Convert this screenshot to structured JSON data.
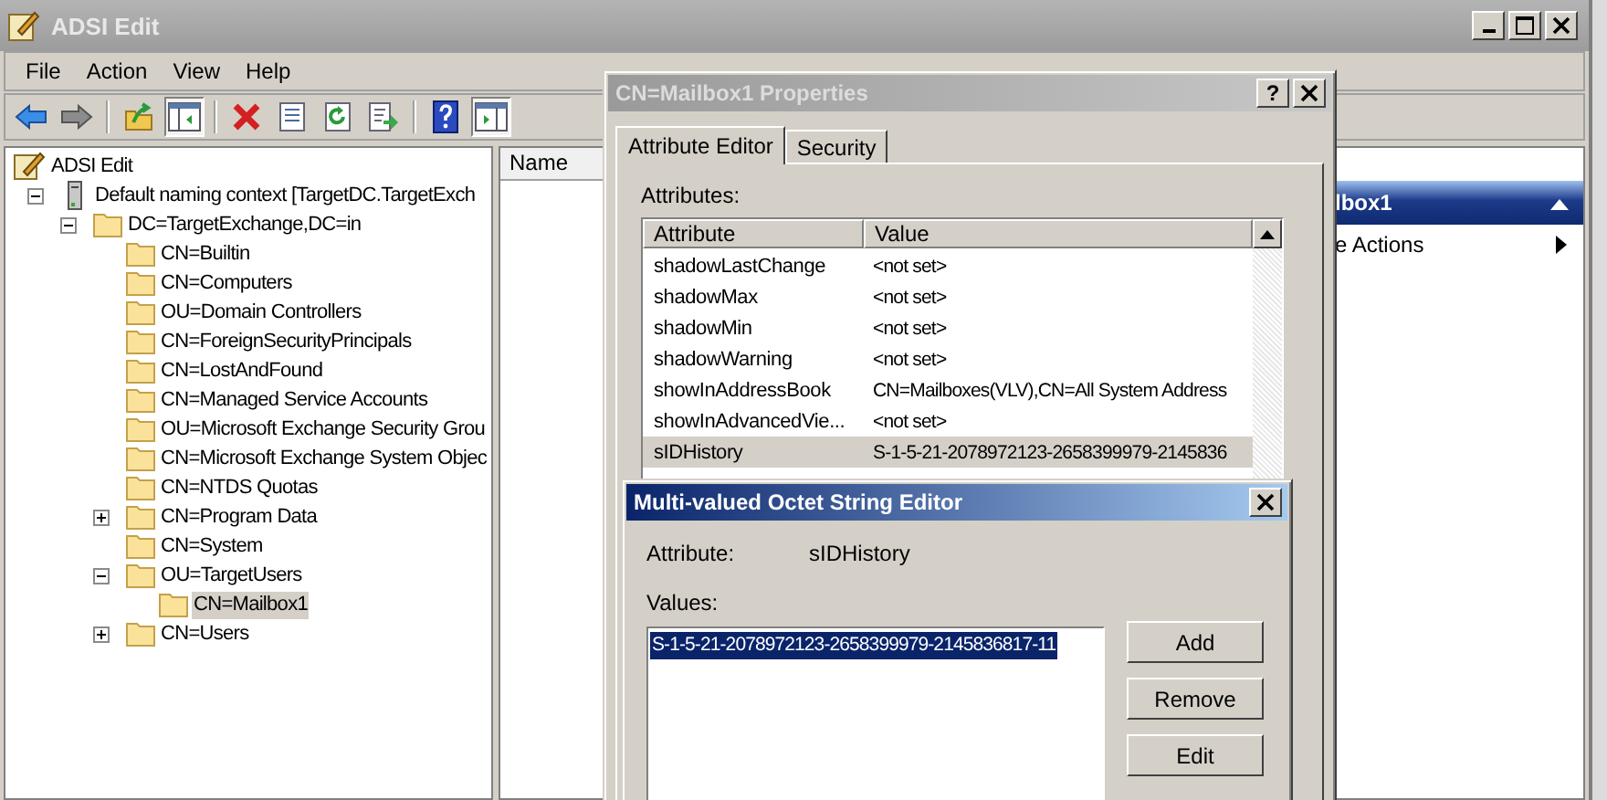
{
  "main_window": {
    "title": "ADSI Edit",
    "menu": [
      "File",
      "Action",
      "View",
      "Help"
    ],
    "toolbar": [
      {
        "kind": "back",
        "pressed": false
      },
      {
        "kind": "forward",
        "pressed": false
      },
      {
        "kind": "separator"
      },
      {
        "kind": "up",
        "pressed": false
      },
      {
        "kind": "tree",
        "pressed": true
      },
      {
        "kind": "separator"
      },
      {
        "kind": "delete",
        "pressed": false
      },
      {
        "kind": "properties",
        "pressed": false
      },
      {
        "kind": "refresh",
        "pressed": false
      },
      {
        "kind": "export",
        "pressed": false
      },
      {
        "kind": "separator"
      },
      {
        "kind": "help",
        "pressed": false
      },
      {
        "kind": "actionpane",
        "pressed": true
      }
    ],
    "tree": [
      {
        "label": "ADSI Edit",
        "kind": "root",
        "expandable": false,
        "selected": false,
        "children": [
          {
            "label": "Default naming context [TargetDC.TargetExch",
            "kind": "server",
            "expandable": true,
            "expanded": true,
            "selected": false,
            "children": [
              {
                "label": "DC=TargetExchange,DC=in",
                "kind": "folder",
                "expandable": true,
                "expanded": true,
                "selected": false,
                "children": [
                  {
                    "label": "CN=Builtin",
                    "kind": "folder",
                    "expandable": false,
                    "selected": false
                  },
                  {
                    "label": "CN=Computers",
                    "kind": "folder",
                    "expandable": false,
                    "selected": false
                  },
                  {
                    "label": "OU=Domain Controllers",
                    "kind": "folder",
                    "expandable": false,
                    "selected": false
                  },
                  {
                    "label": "CN=ForeignSecurityPrincipals",
                    "kind": "folder",
                    "expandable": false,
                    "selected": false
                  },
                  {
                    "label": "CN=LostAndFound",
                    "kind": "folder",
                    "expandable": false,
                    "selected": false
                  },
                  {
                    "label": "CN=Managed Service Accounts",
                    "kind": "folder",
                    "expandable": false,
                    "selected": false
                  },
                  {
                    "label": "OU=Microsoft Exchange Security Grou",
                    "kind": "folder",
                    "expandable": false,
                    "selected": false
                  },
                  {
                    "label": "CN=Microsoft Exchange System Objec",
                    "kind": "folder",
                    "expandable": false,
                    "selected": false
                  },
                  {
                    "label": "CN=NTDS Quotas",
                    "kind": "folder",
                    "expandable": false,
                    "selected": false
                  },
                  {
                    "label": "CN=Program Data",
                    "kind": "folder",
                    "expandable": true,
                    "expanded": false,
                    "selected": false
                  },
                  {
                    "label": "CN=System",
                    "kind": "folder",
                    "expandable": false,
                    "selected": false
                  },
                  {
                    "label": "OU=TargetUsers",
                    "kind": "folder",
                    "expandable": true,
                    "expanded": true,
                    "selected": false,
                    "children": [
                      {
                        "label": "CN=Mailbox1",
                        "kind": "folder",
                        "expandable": false,
                        "selected": true
                      }
                    ]
                  },
                  {
                    "label": "CN=Users",
                    "kind": "folder",
                    "expandable": true,
                    "expanded": false,
                    "selected": false
                  }
                ]
              }
            ]
          }
        ]
      }
    ],
    "results": {
      "columns": [
        "Name"
      ]
    },
    "actions": {
      "header": "lbox1",
      "items": [
        "e Actions"
      ]
    }
  },
  "properties_dialog": {
    "title": "CN=Mailbox1 Properties",
    "help_button": "?",
    "tabs": [
      {
        "label": "Attribute Editor",
        "selected": true
      },
      {
        "label": "Security",
        "selected": false
      }
    ],
    "attributes_label": "Attributes:",
    "columns": [
      "Attribute",
      "Value"
    ],
    "rows": [
      {
        "attribute": "shadowLastChange",
        "value": "<not set>",
        "selected": false
      },
      {
        "attribute": "shadowMax",
        "value": "<not set>",
        "selected": false
      },
      {
        "attribute": "shadowMin",
        "value": "<not set>",
        "selected": false
      },
      {
        "attribute": "shadowWarning",
        "value": "<not set>",
        "selected": false
      },
      {
        "attribute": "showInAddressBook",
        "value": "CN=Mailboxes(VLV),CN=All System Address",
        "selected": false
      },
      {
        "attribute": "showInAdvancedVie...",
        "value": "<not set>",
        "selected": false
      },
      {
        "attribute": "sIDHistory",
        "value": "S-1-5-21-2078972123-2658399979-2145836",
        "selected": true
      }
    ]
  },
  "octet_editor": {
    "title": "Multi-valued Octet String Editor",
    "attribute_label": "Attribute:",
    "attribute_value": "sIDHistory",
    "values_label": "Values:",
    "values": [
      {
        "text": "S-1-5-21-2078972123-2658399979-2145836817-11",
        "selected": true
      }
    ],
    "buttons": [
      "Add",
      "Remove",
      "Edit"
    ]
  }
}
